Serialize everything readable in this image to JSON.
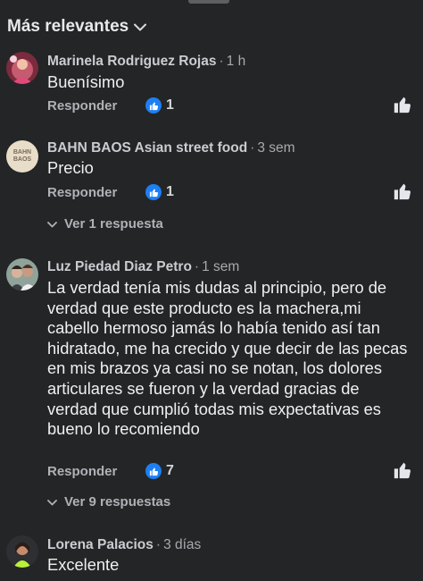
{
  "header": {
    "sort_label": "Más relevantes",
    "sort_icon": "chevron-down-icon"
  },
  "comments": [
    {
      "author": "Marinela Rodriguez Rojas",
      "time": "1 h",
      "text": "Buenísimo",
      "reply_label": "Responder",
      "reaction_count": "1"
    },
    {
      "author": "BAHN BAOS Asian street food",
      "avatar_text": "BAHN BAOS",
      "time": "3 sem",
      "text": "Precio",
      "reply_label": "Responder",
      "reaction_count": "1",
      "replies_label": "Ver 1 respuesta"
    },
    {
      "author": "Luz Piedad Diaz Petro",
      "time": "1 sem",
      "text": "La verdad tenía mis dudas al principio, pero de verdad que este producto es la machera,mi cabello hermoso jamás lo había tenido así tan hidratado, me ha crecido y que decir de las pecas en mis brazos ya casi no se notan, los dolores articulares se fueron y la verdad gracias de verdad que cumplió todas mis expectativas es bueno lo recomiendo",
      "reply_label": "Responder",
      "reaction_count": "7",
      "replies_label": "Ver 9 respuestas"
    },
    {
      "author": "Lorena Palacios",
      "time": "3 días",
      "text": "Excelente"
    }
  ],
  "colors": {
    "background": "#242526",
    "like_blue": "#1d7ff4",
    "secondary_text": "#aeb2b7"
  }
}
